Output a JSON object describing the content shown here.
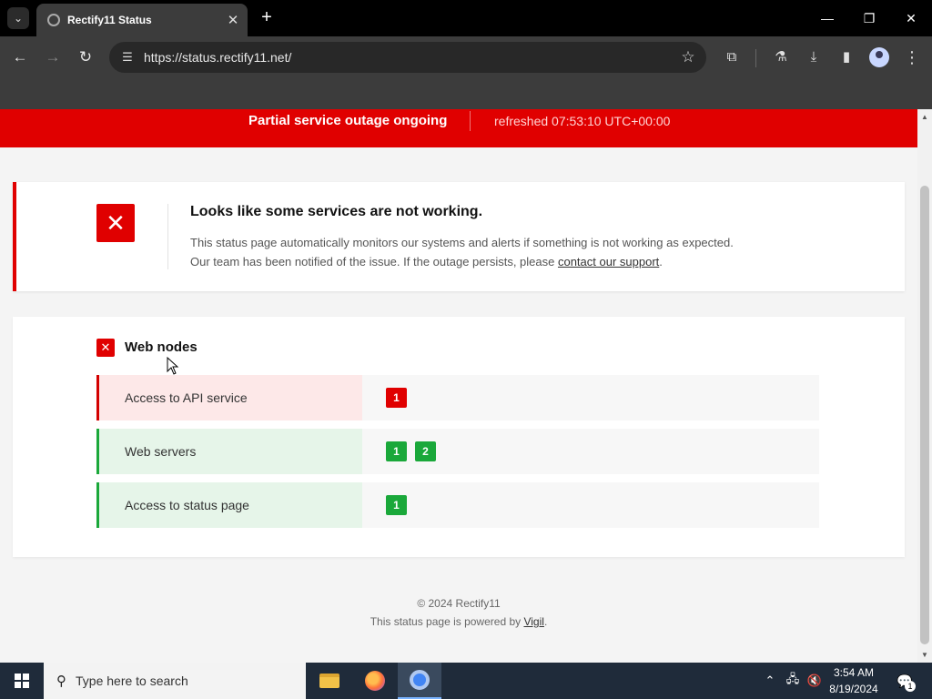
{
  "browser": {
    "tab_title": "Rectify11 Status",
    "url": "https://status.rectify11.net/",
    "icons": {
      "tab_search": "chevron-down-icon",
      "close_tab": "close-icon",
      "new_tab": "plus-icon",
      "back": "back-arrow-icon",
      "forward": "forward-arrow-icon",
      "reload": "reload-icon",
      "site_info": "tune-icon",
      "bookmark": "star-icon",
      "extensions": "puzzle-icon",
      "labs": "flask-icon",
      "downloads": "download-icon",
      "side_panel": "side-panel-icon",
      "profile": "profile-icon",
      "menu": "kebab-menu-icon"
    }
  },
  "banner": {
    "title": "Partial service outage ongoing",
    "refreshed": "refreshed 07:53:10 UTC+00:00",
    "color": "#e00000"
  },
  "alert": {
    "title": "Looks like some services are not working.",
    "line1": "This status page automatically monitors our systems and alerts if something is not working as expected.",
    "line2_prefix": "Our team has been notified of the issue. If the outage persists, please ",
    "line2_link": "contact our support",
    "line2_suffix": "."
  },
  "nodes": {
    "title": "Web nodes",
    "services": [
      {
        "label": "Access to API service",
        "status": "down",
        "badges": [
          "1"
        ]
      },
      {
        "label": "Web servers",
        "status": "up",
        "badges": [
          "1",
          "2"
        ]
      },
      {
        "label": "Access to status page",
        "status": "up",
        "badges": [
          "1"
        ]
      }
    ]
  },
  "footer": {
    "copyright": "© 2024 Rectify11",
    "powered_prefix": "This status page is powered by ",
    "powered_link": "Vigil",
    "powered_suffix": "."
  },
  "taskbar": {
    "search_placeholder": "Type here to search",
    "time": "3:54 AM",
    "date": "8/19/2024",
    "notification_count": "1"
  },
  "colors": {
    "down": "#e00000",
    "up": "#1aa83a",
    "down_bg": "#fde8e8",
    "up_bg": "#e6f5e9"
  }
}
